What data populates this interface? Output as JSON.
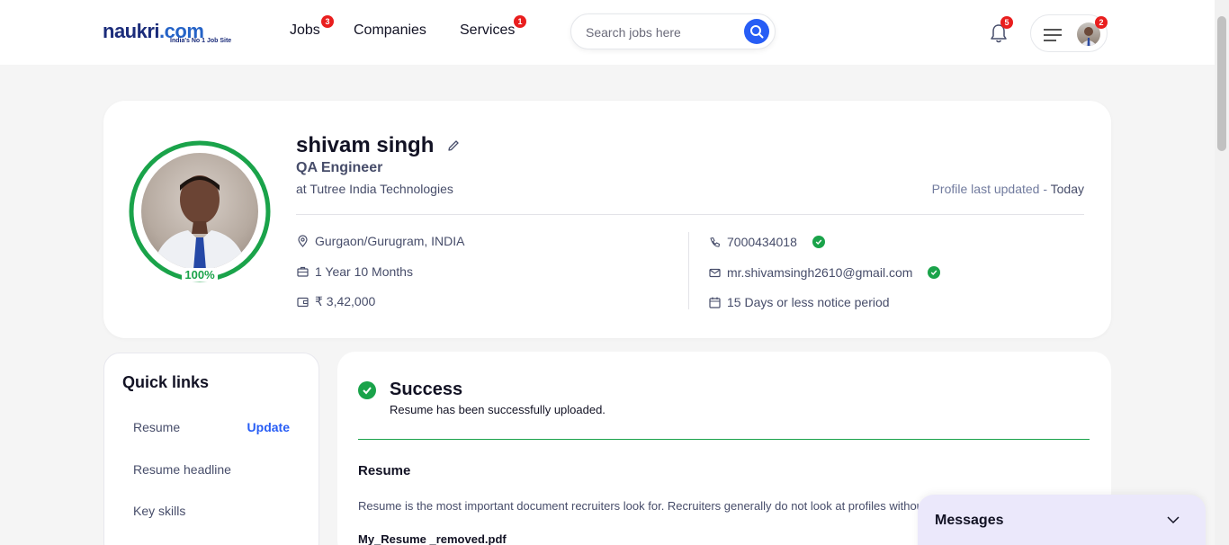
{
  "header": {
    "logo_text": "naukri",
    "logo_domain": ".com",
    "logo_tagline": "India's No 1 Job Site",
    "nav": [
      {
        "label": "Jobs",
        "badge": "3"
      },
      {
        "label": "Companies",
        "badge": ""
      },
      {
        "label": "Services",
        "badge": "1"
      }
    ],
    "search_placeholder": "Search jobs here",
    "notification_count": "5",
    "menu_badge": "2"
  },
  "profile": {
    "name": "shivam singh",
    "designation": "QA Engineer",
    "company": "at Tutree India Technologies",
    "completion": "100%",
    "updated_label": "Profile last updated - ",
    "updated_value": "Today",
    "location": "Gurgaon/Gurugram, INDIA",
    "experience": "1 Year 10 Months",
    "salary": "₹ 3,42,000",
    "phone": "7000434018",
    "email": "mr.shivamsingh2610@gmail.com",
    "notice": "15 Days or less notice period"
  },
  "quick_links": {
    "title": "Quick links",
    "items": [
      "Resume",
      "Resume headline",
      "Key skills"
    ],
    "update_label": "Update"
  },
  "main": {
    "success_title": "Success",
    "success_message": "Resume has been successfully uploaded.",
    "resume_heading": "Resume",
    "resume_description": "Resume is the most important document recruiters look for. Recruiters generally do not look at profiles without resumes.",
    "resume_file": "My_Resume _removed.pdf"
  },
  "messages": {
    "title": "Messages"
  },
  "colors": {
    "accent": "#275df5",
    "success": "#1aa34a",
    "badge": "#e91e1e"
  }
}
